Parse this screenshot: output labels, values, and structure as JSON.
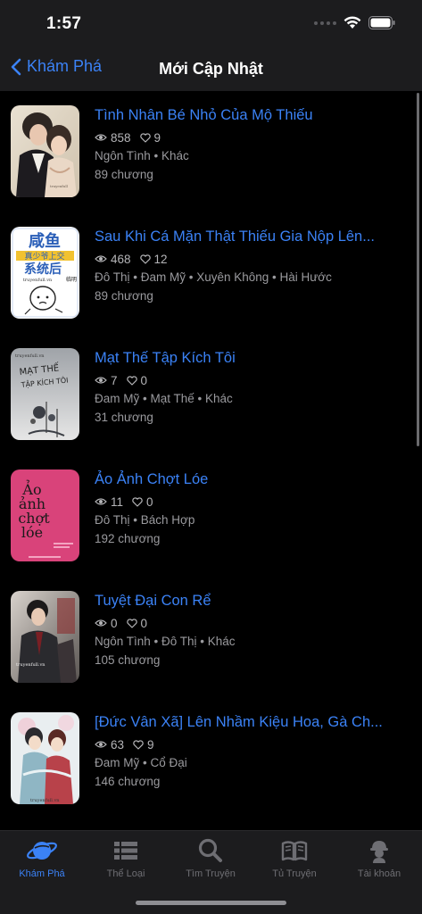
{
  "status": {
    "time": "1:57"
  },
  "nav": {
    "back_label": "Khám Phá",
    "title": "Mới Cập Nhật"
  },
  "colors": {
    "accent": "#3b82f6",
    "background": "#000000",
    "bar": "#1c1c1e"
  },
  "books": [
    {
      "title": "Tình Nhân Bé Nhỏ Của Mộ Thiếu",
      "views": "858",
      "likes": "9",
      "genres": "Ngôn Tình • Khác",
      "chapters": "89 chương"
    },
    {
      "title": "Sau Khi Cá Mặn Thật Thiếu Gia Nộp Lên...",
      "views": "468",
      "likes": "12",
      "genres": "Đô Thị • Đam Mỹ • Xuyên Không • Hài Hước",
      "chapters": "89 chương"
    },
    {
      "title": "Mạt Thế Tập Kích Tôi",
      "views": "7",
      "likes": "0",
      "genres": "Đam Mỹ • Mạt Thế • Khác",
      "chapters": "31 chương"
    },
    {
      "title": "Ảo Ảnh Chợt Lóe",
      "views": "11",
      "likes": "0",
      "genres": "Đô Thị • Bách Hợp",
      "chapters": "192 chương"
    },
    {
      "title": "Tuyệt Đại Con Rể",
      "views": "0",
      "likes": "0",
      "genres": "Ngôn Tình • Đô Thị • Khác",
      "chapters": "105 chương"
    },
    {
      "title": "[Đức Vân Xã] Lên Nhầm Kiệu Hoa, Gà Ch...",
      "views": "63",
      "likes": "9",
      "genres": "Đam Mỹ • Cổ Đại",
      "chapters": "146 chương"
    }
  ],
  "covers": [
    {
      "watermark": "truyenfull"
    },
    {
      "line1": "咸鱼",
      "line2": "真少爷上交",
      "line3": "系统后",
      "site": "truyenfull.vn",
      "side": "临明"
    },
    {
      "site": "truyenfull.vn",
      "line1": "MẠT THẾ",
      "line2": "TẬP KÍCH TÔI"
    },
    {
      "line1": "Ảo",
      "line2": "ảnh",
      "line3": "chợt",
      "line4": "lóe"
    },
    {
      "site": "truyenfull.vn"
    },
    {
      "site": "truyenfull.vn"
    }
  ],
  "tabs": [
    {
      "label": "Khám Phá",
      "icon": "planet-icon",
      "active": true
    },
    {
      "label": "Thể Loại",
      "icon": "list-icon",
      "active": false
    },
    {
      "label": "Tìm Truyện",
      "icon": "search-icon",
      "active": false
    },
    {
      "label": "Tủ Truyện",
      "icon": "book-icon",
      "active": false
    },
    {
      "label": "Tài khoản",
      "icon": "user-icon",
      "active": false
    }
  ]
}
